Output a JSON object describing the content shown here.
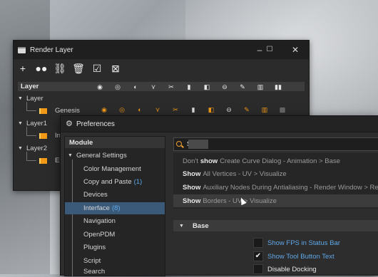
{
  "render_layer": {
    "title": "Render Layer",
    "toolbar": [
      "plus-icon",
      "two-circles-icon",
      "layer-link-icon",
      "trash-icon",
      "checklist-icon",
      "layer-remove-icon"
    ],
    "header": {
      "label": "Layer"
    },
    "rows": [
      {
        "label": "Layer"
      },
      {
        "label": "Genesis"
      },
      {
        "label": "Layer1"
      },
      {
        "label": "In"
      },
      {
        "label": "Layer2"
      },
      {
        "label": "Ex"
      }
    ]
  },
  "preferences": {
    "title": "Preferences",
    "module_header": "Module",
    "modules": [
      {
        "label": "General Settings",
        "count": ""
      },
      {
        "label": "Color Management",
        "count": ""
      },
      {
        "label": "Copy and Paste",
        "count": "(1)"
      },
      {
        "label": "Devices",
        "count": ""
      },
      {
        "label": "Interface",
        "count": "(8)"
      },
      {
        "label": "Navigation",
        "count": ""
      },
      {
        "label": "OpenPDM",
        "count": ""
      },
      {
        "label": "Plugins",
        "count": ""
      },
      {
        "label": "Script",
        "count": ""
      },
      {
        "label": "Search",
        "count": ""
      }
    ],
    "search": {
      "value": "Show",
      "placeholder": ""
    },
    "suggestions": [
      {
        "pre": "Don't",
        "kw": "show",
        "rest": "Create Curve Dialog - Animation > Base"
      },
      {
        "pre": "",
        "kw": "Show",
        "rest": "All Vertices - UV > Visualize"
      },
      {
        "pre": "",
        "kw": "Show",
        "rest": "Auxiliary Nodes During Antialiasing - Render Window > Realti"
      },
      {
        "pre": "",
        "kw": "Show",
        "rest": "Borders - UV > Visualize"
      }
    ],
    "section": "Base",
    "options": [
      {
        "label": "Show FPS in Status Bar",
        "checked": false
      },
      {
        "label": "Show Tool Button Text",
        "checked": true
      },
      {
        "label": "Disable Docking",
        "checked": false
      }
    ],
    "accent": "#5fa8e8"
  }
}
